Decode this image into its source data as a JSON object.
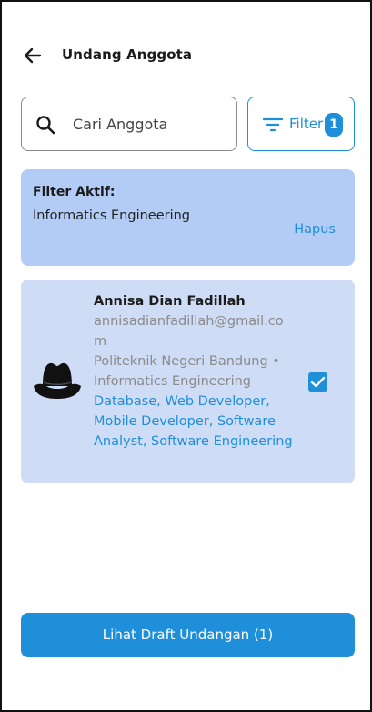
{
  "header": {
    "title": "Undang Anggota",
    "back_icon": "arrow-left-icon"
  },
  "search": {
    "placeholder": "Cari Anggota",
    "value": "",
    "icon": "search-icon"
  },
  "filter_button": {
    "label": "Filter",
    "badge_count": "1",
    "icon": "filter-lines-icon"
  },
  "active_filter": {
    "title": "Filter Aktif:",
    "value": "Informatics Engineering",
    "clear_label": "Hapus"
  },
  "members": [
    {
      "name": "Annisa Dian Fadillah",
      "email": "annisadianfadillah@gmail.com",
      "campus": "Politeknik Negeri Bandung • Informatics Engineering",
      "skills": "Database, Web Developer, Mobile Developer, Software Analyst, Software Engineering",
      "avatar_icon": "hat-avatar-icon",
      "selected": true
    }
  ],
  "draft_button": {
    "label": "Lihat Draft Undangan (1)"
  },
  "colors": {
    "accent": "#1e8fd8",
    "active_filter_bg": "#b3ccf5",
    "member_card_bg": "#cfdcf5",
    "muted_text": "#8a8a8a"
  }
}
